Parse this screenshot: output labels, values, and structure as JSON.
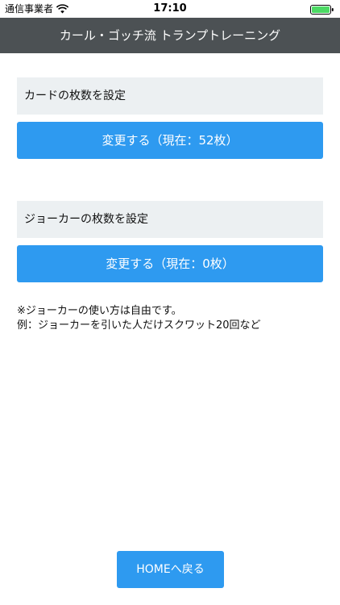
{
  "status_bar": {
    "carrier": "通信事業者",
    "time": "17:10",
    "wifi_icon": "wifi-icon",
    "battery_icon": "battery-full-icon",
    "battery_color": "#4cd964"
  },
  "nav": {
    "title": "カール・ゴッチ流 トランプトレーニング",
    "background": "#4c5154"
  },
  "cards_section": {
    "label": "カードの枚数を設定",
    "button_label": "変更する（現在：52枚）"
  },
  "joker_section": {
    "label": "ジョーカーの枚数を設定",
    "button_label": "変更する（現在：0枚）"
  },
  "note": {
    "line1": "※ジョーカーの使い方は自由です。",
    "line2": "例：ジョーカーを引いた人だけスクワット20回など"
  },
  "home_button": {
    "label": "HOMEへ戻る"
  },
  "colors": {
    "accent": "#2e9af0",
    "label_background": "#ecf0f2"
  }
}
